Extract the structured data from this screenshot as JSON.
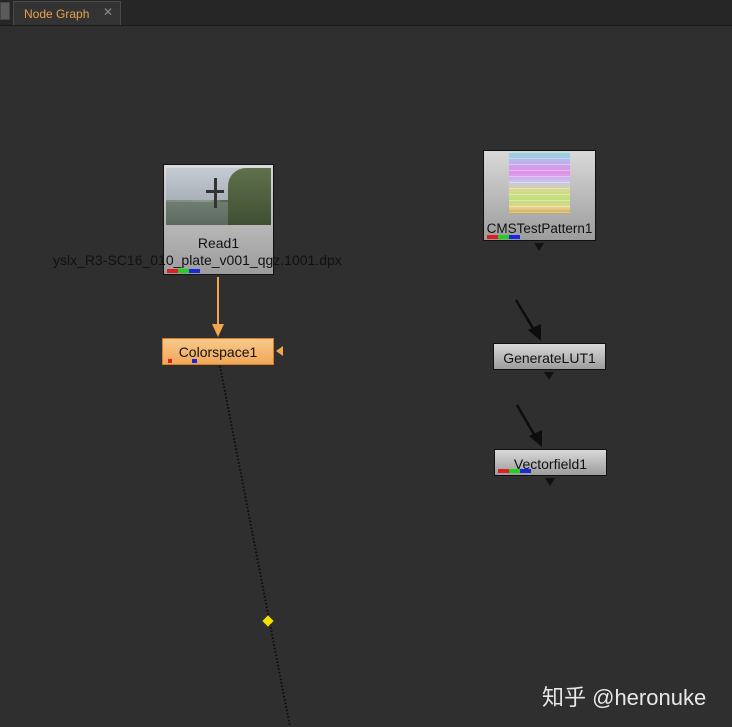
{
  "tab": {
    "label": "Node Graph",
    "close_symbol": "✕"
  },
  "nodes": {
    "read": {
      "title": "Read1",
      "file": "yslx_R3-SC16_010_plate_v001_qgz.1001.dpx"
    },
    "colorspace": {
      "title": "Colorspace1",
      "selected": true
    },
    "cms": {
      "title": "CMSTestPattern1"
    },
    "genlut": {
      "title": "GenerateLUT1"
    },
    "vectorfield": {
      "title": "Vectorfield1"
    }
  },
  "colors": {
    "tab_text": "#e8a34a",
    "selected_node": "#f4b266",
    "connection_selected": "#f2a54e",
    "dot_marker": "#f4e000",
    "channel_red": "#e02020",
    "channel_green": "#1fd21f",
    "channel_blue": "#1a26e0"
  },
  "watermark": "知乎 @heronuke"
}
